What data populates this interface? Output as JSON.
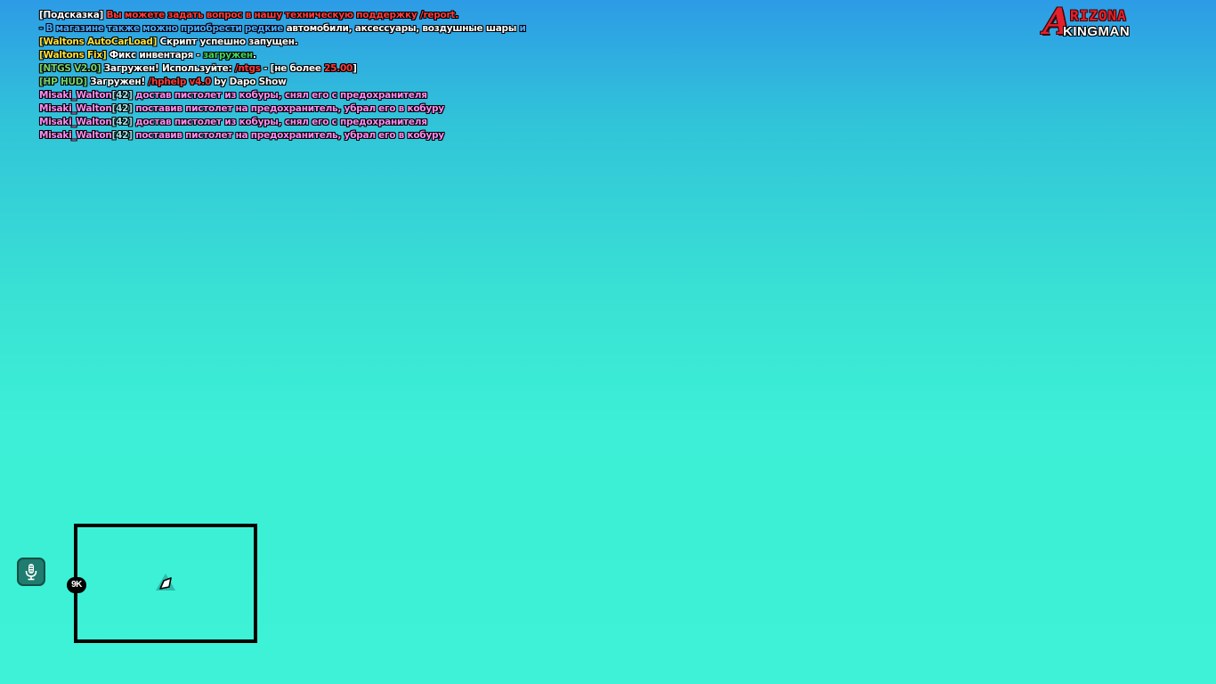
{
  "chat": {
    "lines": [
      [
        {
          "t": "[Подсказка] ",
          "c": "white"
        },
        {
          "t": "Вы можете задать вопрос в нашу техническую поддержку /report.",
          "c": "red"
        }
      ],
      [
        {
          "t": "- В магазине также можно приобрести редкие ",
          "c": "blue"
        },
        {
          "t": "автомобили, аксессуары, воздушные шары ",
          "c": "white"
        },
        {
          "t": "и",
          "c": "blue"
        }
      ],
      [
        {
          "t": "[Waltons AutoCarLoad]",
          "c": "yellow"
        },
        {
          "t": " Скрипт успешно запущен.",
          "c": "white"
        }
      ],
      [
        {
          "t": "[Waltons Fix]",
          "c": "yellow"
        },
        {
          "t": " Фикс инвентаря - ",
          "c": "white"
        },
        {
          "t": "загружен",
          "c": "green"
        },
        {
          "t": ".",
          "c": "white"
        }
      ],
      [
        {
          "t": "[NTGS V2.0]",
          "c": "lgreen"
        },
        {
          "t": " Загружен! Используйте: ",
          "c": "white"
        },
        {
          "t": "/ntgs",
          "c": "red"
        },
        {
          "t": " - [не более ",
          "c": "white"
        },
        {
          "t": "25.00",
          "c": "red"
        },
        {
          "t": "]",
          "c": "white"
        }
      ],
      [
        {
          "t": "[HP HUD]",
          "c": "lgreen"
        },
        {
          "t": " Загружен! ",
          "c": "white"
        },
        {
          "t": "/hphelp v4.0",
          "c": "red"
        },
        {
          "t": " by Dapo Show",
          "c": "white"
        }
      ],
      [
        {
          "t": "Misaki_Walton",
          "c": "pink"
        },
        {
          "t": "[42]",
          "c": "grey"
        },
        {
          "t": " достав пистолет из кобуры, снял его с предохранителя",
          "c": "pink"
        }
      ],
      [
        {
          "t": "Misaki_Walton",
          "c": "pink"
        },
        {
          "t": "[42]",
          "c": "grey"
        },
        {
          "t": " поставив пистолет на предохранитель, убрал его в кобуру",
          "c": "pink"
        }
      ],
      [
        {
          "t": "Misaki_Walton",
          "c": "pink"
        },
        {
          "t": "[42]",
          "c": "grey"
        },
        {
          "t": " достав пистолет из кобуры, снял его с предохранителя",
          "c": "pink"
        }
      ],
      [
        {
          "t": "Misaki_Walton",
          "c": "pink"
        },
        {
          "t": "[42]",
          "c": "grey"
        },
        {
          "t": " поставив пистолет на предохранитель, убрал его в кобуру",
          "c": "pink"
        }
      ]
    ]
  },
  "logo": {
    "letter": "A",
    "top_text": "RIZONA",
    "bottom_text": "KINGMAN"
  },
  "minimap": {
    "zoom_label": "9K"
  },
  "voice": {
    "icon": "microphone-icon"
  },
  "colors": {
    "sky_top": "#2d9be6",
    "sky_bottom": "#3df2d6",
    "logo_red": "#e5202a",
    "voice_button": "#1f7c6e"
  }
}
